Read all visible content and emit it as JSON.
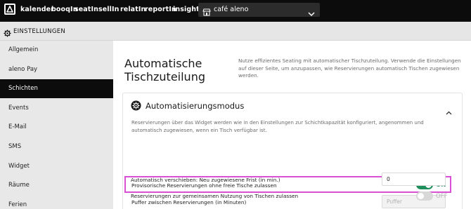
{
  "nav": {
    "items": [
      "kalender",
      "booqIn",
      "seatIn",
      "sellIn",
      "relatIn",
      "reportIn",
      "insights"
    ],
    "venue": "café aleno"
  },
  "settings": {
    "label": "EINSTELLUNGEN"
  },
  "sidebar": {
    "items": [
      "Allgemein",
      "aleno Pay",
      "Schichten",
      "Events",
      "E-Mail",
      "SMS",
      "Widget",
      "Räume",
      "Ferien"
    ],
    "active": "Schichten"
  },
  "page": {
    "title": "Automatische Tischzuteilung",
    "description": "Nutze effizientes Seating mit automatischer Tischzuteilung. Verwende die Einstellungen auf dieser Seite, um anzupassen, wie Reservierungen automatisch Tischen zugewiesen werden."
  },
  "card": {
    "title": "Automatisierungsmodus",
    "description": "Reservierungen über das Widget werden wie in den Einstellungen zur Schichtkapazität konfiguriert, angenommen und automatisch zugewiesen, wenn ein Tisch verfügbar ist.",
    "rows": {
      "provisional": {
        "label": "Provisorische Reservierungen ohne freie Tische zulassen",
        "state": "ON"
      },
      "buffer": {
        "label": "Puffer zwischen Reservierungen (in Minuten)",
        "placeholder": "Puffer"
      },
      "shift": {
        "label": "Automatisch verschieben: Neu zugewiesene Frist (in min.)",
        "value": "0"
      },
      "shared": {
        "label": "Reservierungen zur gemeinsamen Nutzung von Tischen zulassen",
        "state": "OFF"
      }
    }
  },
  "colors": {
    "accent": "#1e8e5a",
    "highlight": "#d94fd6",
    "topbar": "#0c0c0c"
  },
  "icons": {
    "logo": "aleno-logo-icon",
    "venue": "storefront-icon",
    "settings": "gear-icon",
    "card": "gear-badge-icon",
    "collapse": "chevron-up-icon",
    "dropdown": "chevron-down-icon"
  }
}
